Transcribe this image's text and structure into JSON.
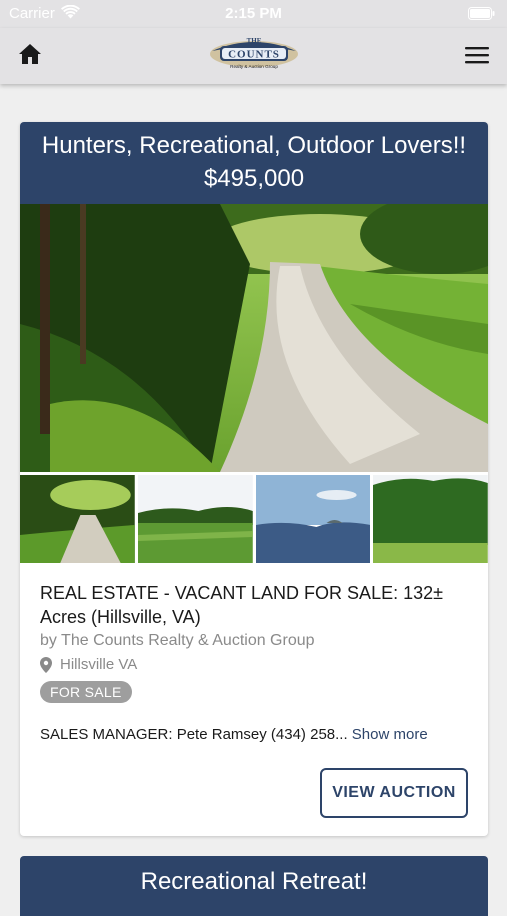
{
  "status_bar": {
    "carrier": "Carrier",
    "time": "2:15 PM",
    "wifi_icon": "wifi-icon",
    "battery_icon": "battery-icon"
  },
  "nav": {
    "home_icon": "home-icon",
    "logo": {
      "top": "THE",
      "name": "COUNTS",
      "sub": "Realty & Auction Group"
    },
    "menu_icon": "hamburger-menu-icon"
  },
  "listing": {
    "headline": "Hunters, Recreational, Outdoor Lovers!!",
    "price": "$495,000",
    "title": "REAL ESTATE - VACANT LAND FOR SALE: 132± Acres (Hillsville, VA)",
    "by": "by The Counts Realty & Auction Group",
    "location": "Hillsville VA",
    "badge": "FOR SALE",
    "description": "SALES MANAGER: Pete Ramsey (434) 258...",
    "show_more": "Show more",
    "button": "VIEW AUCTION"
  },
  "next_listing": {
    "headline": "Recreational Retreat!"
  },
  "colors": {
    "brand_navy": "#2d4469",
    "badge_gray": "#9e9e9e",
    "background": "#efefef",
    "nav_bg": "#e3e2e4"
  }
}
